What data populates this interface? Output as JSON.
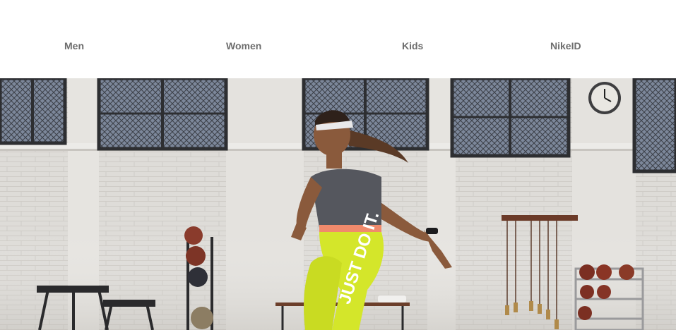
{
  "nav": {
    "items": [
      {
        "label": "Men"
      },
      {
        "label": "Women"
      },
      {
        "label": "Kids"
      },
      {
        "label": "NikeID"
      }
    ]
  },
  "hero": {
    "image": "athlete-running-in-gym",
    "leggings_text": "JUST DO IT.",
    "colors": {
      "wall": "#dcdad6",
      "window_frame": "#2f3033",
      "leggings": "#d4e62a",
      "shirt": "#55575e",
      "ball": "#8a3b2c"
    }
  }
}
